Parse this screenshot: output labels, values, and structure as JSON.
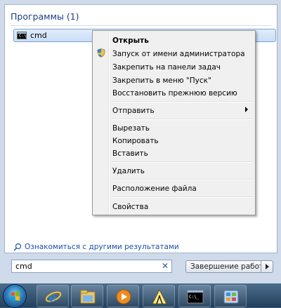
{
  "start_menu": {
    "section_title": "Программы (1)",
    "results": [
      {
        "label": "cmd"
      }
    ],
    "more_results_label": "Ознакомиться с другими результатами",
    "search": {
      "value": "cmd",
      "clear_glyph": "✕"
    },
    "shutdown_label": "Завершение работы"
  },
  "context_menu": {
    "items": [
      {
        "label": "Открыть",
        "bold": true
      },
      {
        "label": "Запуск от имени администратора",
        "icon": "uac-shield-icon"
      },
      {
        "label": "Закрепить на панели задач"
      },
      {
        "label": "Закрепить в меню \"Пуск\""
      },
      {
        "label": "Восстановить прежнюю версию"
      },
      {
        "label": "Отправить",
        "submenu": true
      },
      {
        "label": "Вырезать"
      },
      {
        "label": "Копировать"
      },
      {
        "label": "Вставить"
      },
      {
        "label": "Удалить"
      },
      {
        "label": "Расположение файла"
      },
      {
        "label": "Свойства"
      }
    ]
  },
  "taskbar": {
    "items": [
      {
        "name": "internet-explorer-icon"
      },
      {
        "name": "file-explorer-icon"
      },
      {
        "name": "media-player-icon"
      },
      {
        "name": "paint-icon"
      },
      {
        "name": "command-prompt-icon"
      },
      {
        "name": "control-panel-icon"
      }
    ]
  }
}
